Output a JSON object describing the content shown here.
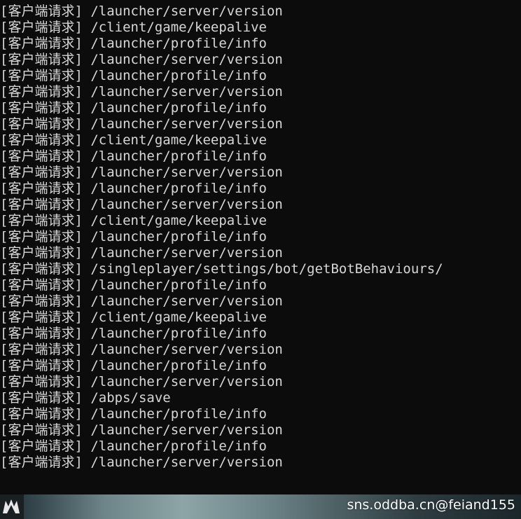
{
  "terminal": {
    "lines": [
      "[客户端请求] /launcher/server/version",
      "[客户端请求] /client/game/keepalive",
      "[客户端请求] /launcher/profile/info",
      "[客户端请求] /launcher/server/version",
      "[客户端请求] /launcher/profile/info",
      "[客户端请求] /launcher/server/version",
      "[客户端请求] /launcher/profile/info",
      "[客户端请求] /launcher/server/version",
      "[客户端请求] /client/game/keepalive",
      "[客户端请求] /launcher/profile/info",
      "[客户端请求] /launcher/server/version",
      "[客户端请求] /launcher/profile/info",
      "[客户端请求] /launcher/server/version",
      "[客户端请求] /client/game/keepalive",
      "[客户端请求] /launcher/profile/info",
      "[客户端请求] /launcher/server/version",
      "[客户端请求] /singleplayer/settings/bot/getBotBehaviours/",
      "[客户端请求] /launcher/profile/info",
      "[客户端请求] /launcher/server/version",
      "[客户端请求] /client/game/keepalive",
      "[客户端请求] /launcher/profile/info",
      "[客户端请求] /launcher/server/version",
      "[客户端请求] /launcher/profile/info",
      "[客户端请求] /launcher/server/version",
      "[客户端请求] /abps/save",
      "[客户端请求] /launcher/profile/info",
      "[客户端请求] /launcher/server/version",
      "[客户端请求] /launcher/profile/info",
      "[客户端请求] /launcher/server/version"
    ],
    "background_color": "#0c0c0c",
    "text_color": "#d7d7d7"
  },
  "watermark": {
    "text": "sns.oddba.cn@feiand155",
    "logo_icon": "logo-icon"
  }
}
